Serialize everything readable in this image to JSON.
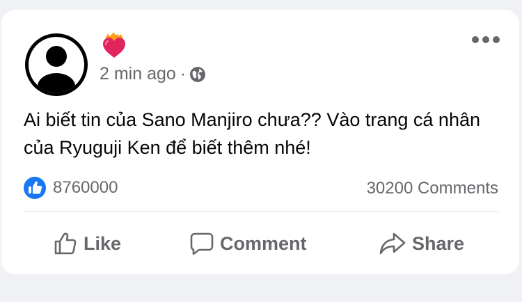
{
  "post": {
    "author_icon": "heart-on-fire-emoji",
    "timestamp": "2 min ago",
    "separator": "·",
    "privacy_icon": "globe-icon",
    "text": "Ai biết tin của Sano Manjiro chưa?? Vào trang cá nhân của Ryuguji Ken để biết thêm nhé!",
    "reactions_count": "8760000",
    "comments_count": "30200 Comments"
  },
  "actions": {
    "like_label": "Like",
    "comment_label": "Comment",
    "share_label": "Share"
  },
  "colors": {
    "background": "#f0f1f5",
    "card": "#ffffff",
    "secondary_text": "#65676b",
    "primary_text": "#050505",
    "like_blue": "#1877f2",
    "heart_red": "#e0245e",
    "flame_orange": "#ff9f1c"
  }
}
